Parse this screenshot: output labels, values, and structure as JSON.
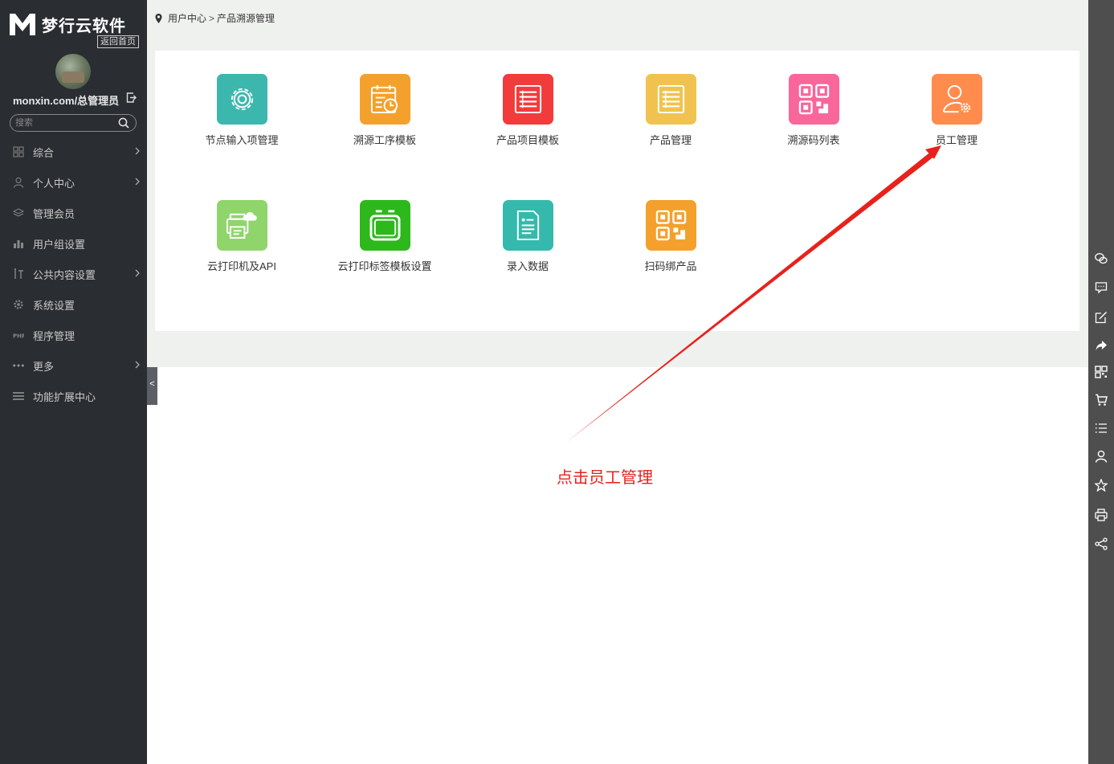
{
  "brand": {
    "logo_letter": "M",
    "name": "梦行云软件",
    "home_link": "返回首页"
  },
  "user": {
    "name": "monxin.com/总管理员"
  },
  "search": {
    "placeholder": "搜索",
    "value": ""
  },
  "sidebar": {
    "items": [
      {
        "label": "综合",
        "icon": "grid-icon",
        "has_children": true
      },
      {
        "label": "个人中心",
        "icon": "user-icon",
        "has_children": true
      },
      {
        "label": "管理会员",
        "icon": "layers-icon",
        "has_children": false
      },
      {
        "label": "用户组设置",
        "icon": "group-chart-icon",
        "has_children": false
      },
      {
        "label": "公共内容设置",
        "icon": "tools-icon",
        "has_children": true
      },
      {
        "label": "系统设置",
        "icon": "gear-icon",
        "has_children": false
      },
      {
        "label": "程序管理",
        "icon": "php-icon",
        "has_children": false
      },
      {
        "label": "更多",
        "icon": "dots-icon",
        "has_children": true
      },
      {
        "label": "功能扩展中心",
        "icon": "menu-lines-icon",
        "has_children": false
      }
    ],
    "collapse_label": "<"
  },
  "breadcrumb": {
    "root": "用户中心",
    "separator": ">",
    "current": "产品溯源管理"
  },
  "tiles": [
    {
      "label": "节点输入项管理",
      "color": "#3bb7ae",
      "icon": "gear-icon"
    },
    {
      "label": "溯源工序模板",
      "color": "#f3a12c",
      "icon": "calendar-clock-icon"
    },
    {
      "label": "产品项目模板",
      "color": "#f23b3b",
      "icon": "list-doc-icon"
    },
    {
      "label": "产品管理",
      "color": "#f0c350",
      "icon": "list-doc-icon"
    },
    {
      "label": "溯源码列表",
      "color": "#f8669a",
      "icon": "qrcode-icon"
    },
    {
      "label": "员工管理",
      "color": "#ff8c4d",
      "icon": "user-settings-icon"
    },
    {
      "label": "云打印机及API",
      "color": "#8fd56b",
      "icon": "cloud-printer-icon"
    },
    {
      "label": "云打印标签模板设置",
      "color": "#2db81c",
      "icon": "tv-frame-icon"
    },
    {
      "label": "录入数据",
      "color": "#35b9ac",
      "icon": "document-icon"
    },
    {
      "label": "扫码绑产品",
      "color": "#f3a12c",
      "icon": "qrcode-icon"
    }
  ],
  "annotation": {
    "text": "点击员工管理",
    "color": "#e8211c"
  },
  "right_toolbar": [
    "wechat-icon",
    "chat-icon",
    "edit-icon",
    "share-arrow-icon",
    "qrcode-icon",
    "cart-icon",
    "list-icon",
    "user-icon",
    "star-icon",
    "print-icon",
    "share-icon"
  ],
  "colors": {
    "sidebar_bg": "#2a2d31",
    "content_band": "#eef1ee",
    "right_bar_bg": "#4e4e4e"
  }
}
